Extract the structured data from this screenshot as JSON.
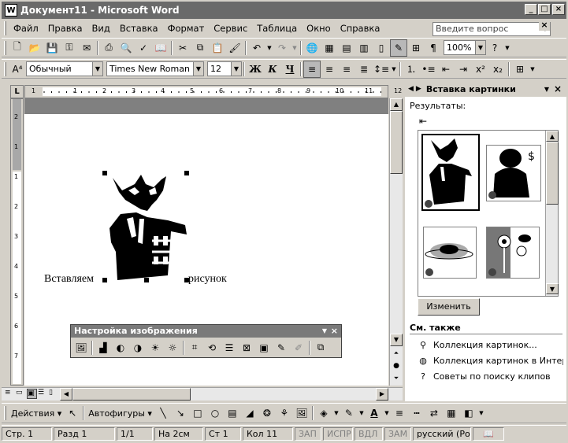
{
  "window": {
    "title": "Документ11 - Microsoft Word",
    "icon_letter": "W"
  },
  "menu": {
    "items": [
      "Файл",
      "Правка",
      "Вид",
      "Вставка",
      "Формат",
      "Сервис",
      "Таблица",
      "Окно",
      "Справка"
    ],
    "ask_placeholder": "Введите вопрос"
  },
  "standard_toolbar": {
    "zoom": "100%"
  },
  "format_toolbar": {
    "style": "Обычный",
    "font": "Times New Roman",
    "size": "12",
    "bold": "Ж",
    "italic": "К",
    "underline": "Ч"
  },
  "document": {
    "text_before": "Вставляем",
    "text_after": "рисунок"
  },
  "task_pane": {
    "title": "Вставка картинки",
    "results_label": "Результаты:",
    "modify_button": "Изменить",
    "see_also": "См. также",
    "links": [
      "Коллекция картинок...",
      "Коллекция картинок в Интернете",
      "Советы по поиску клипов"
    ]
  },
  "picture_toolbar": {
    "title": "Настройка изображения"
  },
  "drawing_toolbar": {
    "actions": "Действия",
    "autoshapes": "Автофигуры"
  },
  "status_bar": {
    "page": "Стр. 1",
    "section": "Разд 1",
    "pages": "1/1",
    "at": "На 2см",
    "line": "Ст 1",
    "col": "Кол 11",
    "rec": "ЗАП",
    "trk": "ИСПР",
    "ext": "ВДЛ",
    "ovr": "ЗАМ",
    "language": "русский (Ро"
  },
  "ruler": {
    "h_numbers": [
      "1",
      "1",
      "2",
      "3",
      "4",
      "5",
      "6",
      "7",
      "8",
      "9",
      "10",
      "11",
      "12"
    ],
    "v_numbers": [
      "2",
      "1",
      "1",
      "2",
      "3",
      "4",
      "5",
      "6",
      "7"
    ]
  }
}
